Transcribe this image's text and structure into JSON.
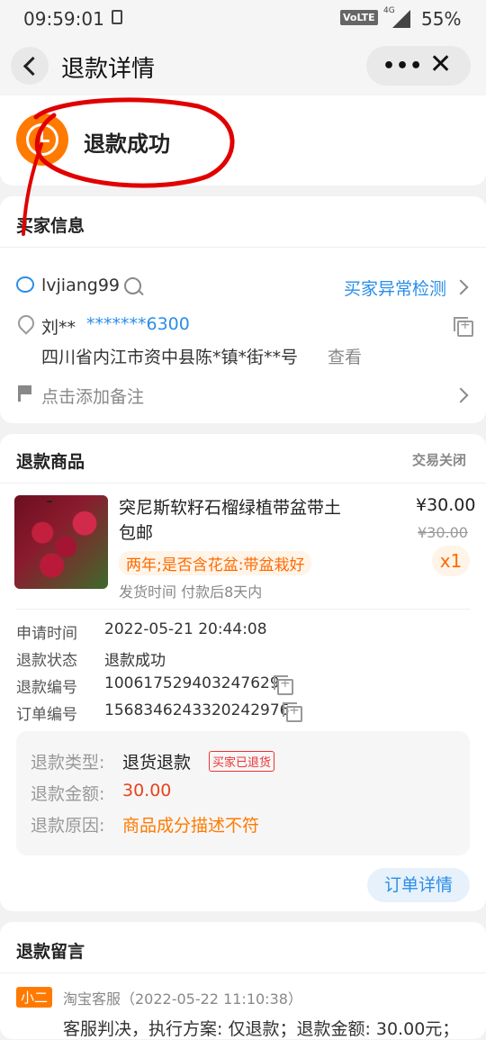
{
  "status_bar": {
    "time": "09:59:01",
    "network": "VoLTE",
    "signal": "4G",
    "battery": "55%"
  },
  "nav": {
    "title": "退款详情",
    "more_label": "•••",
    "close_label": "✕"
  },
  "refund_status": {
    "text": "退款成功",
    "accent": "#ff7a00"
  },
  "buyer": {
    "title": "买家信息",
    "username": "lvjiang99",
    "anomaly_check": "买家异常检测",
    "name": "刘**",
    "phone": "*******6300",
    "address": "四川省内江市资中县陈*镇*街**号",
    "view_label": "查看",
    "remark_placeholder": "点击添加备注"
  },
  "goods": {
    "title": "退款商品",
    "trade_status": "交易关闭",
    "product_name": "突尼斯软籽石榴绿植带盆带土包邮",
    "price": "¥30.00",
    "original_price": "¥30.00",
    "spec": "两年;是否含花盆:带盆栽好",
    "quantity": "x1",
    "shipping": "发货时间 付款后8天内",
    "details": [
      {
        "label": "申请时间",
        "value": "2022-05-21 20:44:08"
      },
      {
        "label": "退款状态",
        "value": "退款成功"
      },
      {
        "label": "退款编号",
        "value": "100617529403247629"
      },
      {
        "label": "订单编号",
        "value": "1568346243320242976"
      }
    ],
    "refund_type_label": "退款类型:",
    "refund_type": "退货退款",
    "returned_badge": "买家已退货",
    "refund_amount_label": "退款金额:",
    "refund_amount": "30.00",
    "refund_reason_label": "退款原因:",
    "refund_reason": "商品成分描述不符",
    "order_detail_button": "订单详情"
  },
  "messages": {
    "title": "退款留言",
    "role_badge": "小二",
    "sender": "淘宝客服（2022-05-22 11:10:38）",
    "content": "客服判决，执行方案: 仅退款；退款金额: 30.00元；"
  },
  "colors": {
    "link": "#2a8ee8",
    "orange": "#ff7a00",
    "annotation": "#e00000"
  }
}
